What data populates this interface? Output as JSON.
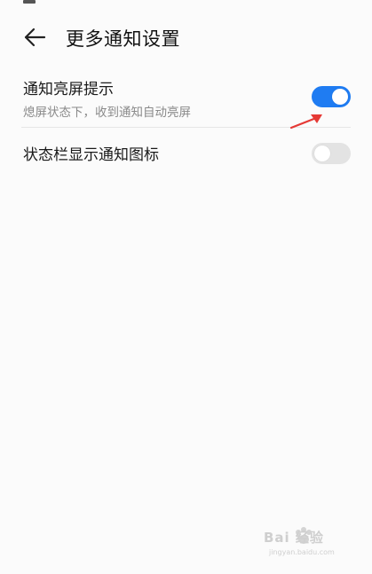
{
  "header": {
    "title": "更多通知设置",
    "back_icon": "arrow-left-icon"
  },
  "settings": [
    {
      "title": "通知亮屏提示",
      "subtitle": "熄屏状态下，收到通知自动亮屏",
      "enabled": true
    },
    {
      "title": "状态栏显示通知图标",
      "enabled": false
    }
  ],
  "colors": {
    "accent": "#1f7cf2",
    "switch_off": "#e3e3e3",
    "arrow": "#e53935"
  },
  "watermark": {
    "text": "Bai 经验",
    "sub": "jingyan.baidu.com"
  }
}
